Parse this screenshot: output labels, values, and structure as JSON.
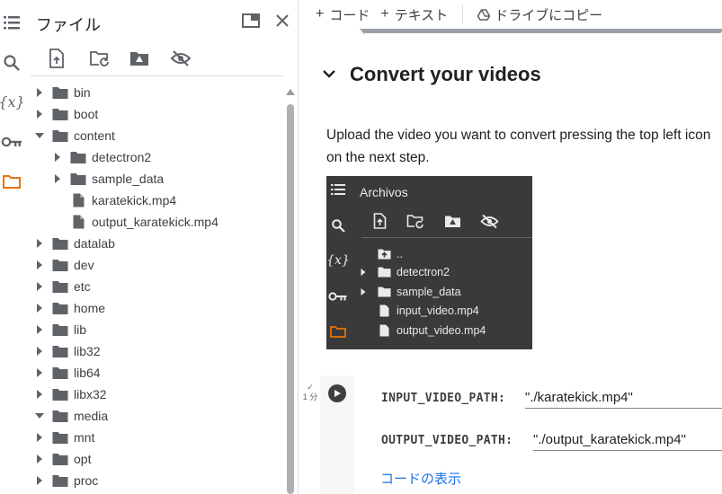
{
  "colors": {
    "accent": "#e8710a",
    "icon": "#5f6368",
    "link": "#1a73e8",
    "dark_bg": "#3a3a3a",
    "folder": "#5f6368"
  },
  "rail": {
    "items": [
      {
        "icon": "toc-list-icon"
      },
      {
        "icon": "search-icon"
      },
      {
        "icon": "variables-icon",
        "label": "{x}"
      },
      {
        "icon": "key-icon"
      },
      {
        "icon": "folder-icon",
        "active": true
      }
    ]
  },
  "panel": {
    "title": "ファイル",
    "toolbar": [
      {
        "icon": "upload-file-icon"
      },
      {
        "icon": "refresh-folder-icon"
      },
      {
        "icon": "mount-drive-icon"
      },
      {
        "icon": "hide-files-icon"
      }
    ],
    "tree": [
      {
        "name": "bin",
        "type": "folder",
        "depth": 0,
        "state": "collapsed"
      },
      {
        "name": "boot",
        "type": "folder",
        "depth": 0,
        "state": "collapsed"
      },
      {
        "name": "content",
        "type": "folder",
        "depth": 0,
        "state": "expanded"
      },
      {
        "name": "detectron2",
        "type": "folder",
        "depth": 1,
        "state": "collapsed"
      },
      {
        "name": "sample_data",
        "type": "folder",
        "depth": 1,
        "state": "collapsed"
      },
      {
        "name": "karatekick.mp4",
        "type": "file",
        "depth": 1,
        "state": "none"
      },
      {
        "name": "output_karatekick.mp4",
        "type": "file",
        "depth": 1,
        "state": "none"
      },
      {
        "name": "datalab",
        "type": "folder",
        "depth": 0,
        "state": "collapsed"
      },
      {
        "name": "dev",
        "type": "folder",
        "depth": 0,
        "state": "collapsed"
      },
      {
        "name": "etc",
        "type": "folder",
        "depth": 0,
        "state": "collapsed"
      },
      {
        "name": "home",
        "type": "folder",
        "depth": 0,
        "state": "collapsed"
      },
      {
        "name": "lib",
        "type": "folder",
        "depth": 0,
        "state": "collapsed"
      },
      {
        "name": "lib32",
        "type": "folder",
        "depth": 0,
        "state": "collapsed"
      },
      {
        "name": "lib64",
        "type": "folder",
        "depth": 0,
        "state": "collapsed"
      },
      {
        "name": "libx32",
        "type": "folder",
        "depth": 0,
        "state": "collapsed"
      },
      {
        "name": "media",
        "type": "folder",
        "depth": 0,
        "state": "expanded"
      },
      {
        "name": "mnt",
        "type": "folder",
        "depth": 0,
        "state": "collapsed"
      },
      {
        "name": "opt",
        "type": "folder",
        "depth": 0,
        "state": "collapsed"
      },
      {
        "name": "proc",
        "type": "folder",
        "depth": 0,
        "state": "collapsed"
      }
    ]
  },
  "notebook": {
    "toolbar": {
      "add_code": "コード",
      "add_text": "テキスト",
      "copy_to_drive": "ドライブにコピー"
    },
    "section_title": "Convert your videos",
    "paragraph_line1": "Upload the video you want to convert pressing the top left icon",
    "paragraph_line2": "on the next step.",
    "embedded_image": {
      "title": "Archivos",
      "variables_label": "{x}",
      "rows": [
        {
          "name": "..",
          "type": "up"
        },
        {
          "name": "detectron2",
          "type": "folder"
        },
        {
          "name": "sample_data",
          "type": "folder"
        },
        {
          "name": "input_video.mp4",
          "type": "file"
        },
        {
          "name": "output_video.mp4",
          "type": "file"
        }
      ]
    },
    "cell": {
      "exec_status": "1 分",
      "fields": [
        {
          "label": "INPUT_VIDEO_PATH:",
          "value": "\"./karatekick.mp4\""
        },
        {
          "label": "OUTPUT_VIDEO_PATH:",
          "value": "\"./output_karatekick.mp4\""
        }
      ],
      "show_code": "コードの表示"
    }
  }
}
